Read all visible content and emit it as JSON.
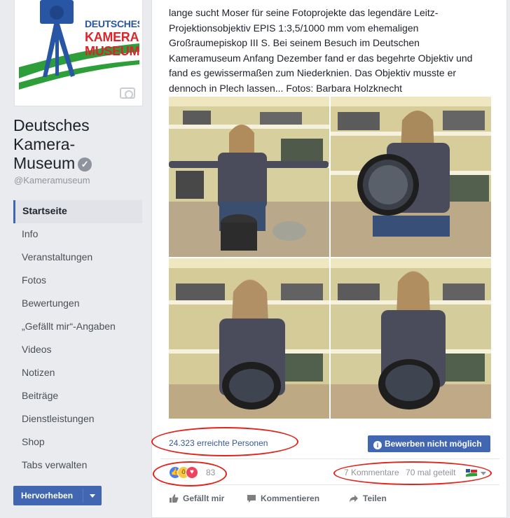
{
  "page": {
    "logo": {
      "line1": "DEUTSCHES",
      "line2": "KAMERA",
      "line3": "MUSEUM"
    },
    "name_line1": "Deutsches",
    "name_line2": "Kamera-",
    "name_line3": "Museum",
    "handle": "@Kameramuseum"
  },
  "sidebar": {
    "items": [
      {
        "label": "Startseite",
        "active": true
      },
      {
        "label": "Info"
      },
      {
        "label": "Veranstaltungen"
      },
      {
        "label": "Fotos"
      },
      {
        "label": "Bewertungen"
      },
      {
        "label": "„Gefällt mir“-Angaben"
      },
      {
        "label": "Videos"
      },
      {
        "label": "Notizen"
      },
      {
        "label": "Beiträge"
      },
      {
        "label": "Dienstleistungen"
      },
      {
        "label": "Shop"
      },
      {
        "label": "Tabs verwalten"
      }
    ],
    "promote_label": "Hervorheben"
  },
  "post": {
    "lines": [
      "lange sucht Moser für seine Fotoprojekte das legendäre Leitz-",
      "Projektionsobjektiv EPIS 1:3,5/1000 mm vom ehemaligen",
      "Großraumepiskop III S. Bei seinem Besuch im Deutschen",
      "Kameramuseum Anfang Dezember fand er das begehrte Objektiv und",
      "fand es gewissermaßen zum Niederknien. Das Objektiv musste er",
      "dennoch in Plech lassen... Fotos: Barbara Holzknecht"
    ],
    "reach_text": "24.323 erreichte Personen",
    "boost_label": "Bewerben nicht möglich",
    "reaction_count": "83",
    "comments": "7 Kommentare",
    "shares": "70 mal geteilt",
    "actions": {
      "like": "Gefällt mir",
      "comment": "Kommentieren",
      "share": "Teilen"
    }
  },
  "colors": {
    "facebook_blue": "#4267b2",
    "link_blue": "#365899",
    "annotation_red": "#e2231a",
    "logo_blue": "#2856a4",
    "logo_red": "#d9252b",
    "logo_green": "#2e9e3a"
  },
  "icons": [
    "camera-icon",
    "verified-icon",
    "caret-down-icon",
    "info-icon",
    "like-reaction-icon",
    "wow-reaction-icon",
    "love-reaction-icon",
    "thumbs-up-icon",
    "comment-icon",
    "share-icon"
  ]
}
